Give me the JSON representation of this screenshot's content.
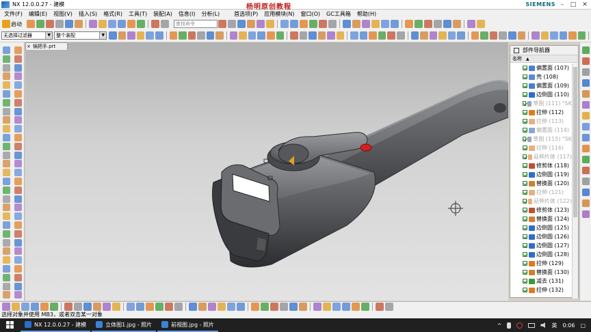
{
  "window": {
    "title": "NX 12.0.0.27 - 建模",
    "watermark": "杨明原创教程",
    "brand": "SIEMENS",
    "min": "–",
    "max": "□",
    "close": "✕"
  },
  "menu": {
    "items": [
      "文件(F)",
      "编辑(E)",
      "视图(V)",
      "插入(S)",
      "格式(R)",
      "工具(T)",
      "装配(A)",
      "信息(I)",
      "分析(L)",
      "首选项(P)",
      "应用模块(N)",
      "窗口(O)",
      "GC工具箱",
      "帮助(H)"
    ]
  },
  "toolbar": {
    "start_label": "启动",
    "search_placeholder": "查找命令",
    "filter_value": "无选择过滤器",
    "assembly_value": "整个装配"
  },
  "viewport": {
    "tab_label": "锅把手.prt",
    "tab_close": "×"
  },
  "navigator": {
    "title": "部件导航器",
    "column_name": "名称",
    "sort_indicator": "▲",
    "items": [
      {
        "label": "偏置面 (107)",
        "suppressed": false,
        "icon_color": "#4a7fd0"
      },
      {
        "label": "壳 (108)",
        "suppressed": false,
        "icon_color": "#5a8ad8"
      },
      {
        "label": "偏置面 (109)",
        "suppressed": false,
        "icon_color": "#4a7fd0"
      },
      {
        "label": "边倒圆 (110)",
        "suppressed": false,
        "icon_color": "#2f6ec8"
      },
      {
        "label": "草图 (111) \"SK",
        "suppressed": true,
        "icon_color": "#9aa6c0"
      },
      {
        "label": "拉伸 (112)",
        "suppressed": false,
        "icon_color": "#e07a1e"
      },
      {
        "label": "拉伸 (113)",
        "suppressed": true,
        "icon_color": "#e8b080"
      },
      {
        "label": "偏置面 (114)",
        "suppressed": true,
        "icon_color": "#8aa6d8"
      },
      {
        "label": "草图 (115) \"SK",
        "suppressed": true,
        "icon_color": "#9aa6c0"
      },
      {
        "label": "拉伸 (116)",
        "suppressed": true,
        "icon_color": "#e8b080"
      },
      {
        "label": "延伸片体 (117)",
        "suppressed": true,
        "icon_color": "#e8b080"
      },
      {
        "label": "修剪体 (118)",
        "suppressed": false,
        "icon_color": "#c05030"
      },
      {
        "label": "边倒圆 (119)",
        "suppressed": false,
        "icon_color": "#2f6ec8"
      },
      {
        "label": "替换面 (120)",
        "suppressed": false,
        "icon_color": "#d08030"
      },
      {
        "label": "拉伸 (121)",
        "suppressed": true,
        "icon_color": "#e8b080"
      },
      {
        "label": "延伸片体 (122)",
        "suppressed": true,
        "icon_color": "#e8b080"
      },
      {
        "label": "修剪体 (123)",
        "suppressed": false,
        "icon_color": "#c05030"
      },
      {
        "label": "替换面 (124)",
        "suppressed": false,
        "icon_color": "#d08030"
      },
      {
        "label": "边倒圆 (125)",
        "suppressed": false,
        "icon_color": "#2f6ec8"
      },
      {
        "label": "边倒圆 (126)",
        "suppressed": false,
        "icon_color": "#2f6ec8"
      },
      {
        "label": "边倒圆 (127)",
        "suppressed": false,
        "icon_color": "#2f6ec8"
      },
      {
        "label": "边倒圆 (128)",
        "suppressed": false,
        "icon_color": "#2f6ec8"
      },
      {
        "label": "拉伸 (129)",
        "suppressed": false,
        "icon_color": "#e07a1e"
      },
      {
        "label": "替换面 (130)",
        "suppressed": false,
        "icon_color": "#d08030"
      },
      {
        "label": "减去 (131)",
        "suppressed": false,
        "icon_color": "#3a9a3a"
      },
      {
        "label": "拉伸 (132)",
        "suppressed": false,
        "icon_color": "#e07a1e"
      }
    ]
  },
  "status": {
    "prompt": "选择对象并使用 MB3，或者双击某一对象"
  },
  "taskbar": {
    "items": [
      {
        "label": "NX 12.0.0.27 - 建模",
        "icon_color": "#2a6fc8"
      },
      {
        "label": "立体图1.jpg - 照片",
        "icon_color": "#3c82d8"
      },
      {
        "label": "前视图.jpg - 照片",
        "icon_color": "#3c82d8"
      }
    ],
    "tray_up": "^",
    "tray_ime": "英",
    "clock": "0:06",
    "notify": "▢"
  },
  "colors": {
    "accent": "#d42020",
    "handle_grey": "#595b5e",
    "tag_orange": "#e0a020"
  }
}
